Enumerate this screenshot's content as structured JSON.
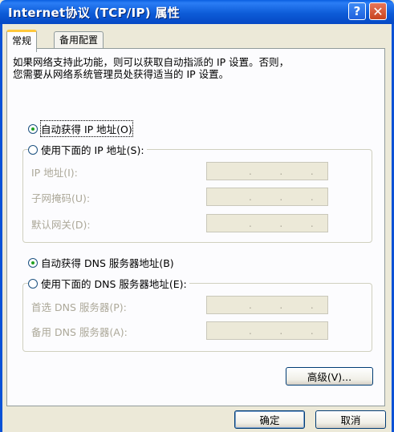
{
  "window": {
    "title": "Internet协议 (TCP/IP) 属性",
    "help_icon": "?",
    "close_icon": "✕"
  },
  "tabs": [
    {
      "label": "常规"
    },
    {
      "label": "备用配置"
    }
  ],
  "description": [
    "如果网络支持此功能，则可以获取自动指派的 IP 设置。否则，",
    "您需要从网络系统管理员处获得适当的 IP 设置。"
  ],
  "ip": {
    "auto_label": "自动获得 IP 地址(O)",
    "manual_label": "使用下面的 IP 地址(S):",
    "selected": "auto",
    "fields": [
      {
        "label": "IP 地址(I):",
        "value": ""
      },
      {
        "label": "子网掩码(U):",
        "value": ""
      },
      {
        "label": "默认网关(D):",
        "value": ""
      }
    ]
  },
  "dns": {
    "auto_label": "自动获得 DNS 服务器地址(B)",
    "manual_label": "使用下面的 DNS 服务器地址(E):",
    "selected": "auto",
    "fields": [
      {
        "label": "首选 DNS 服务器(P):",
        "value": ""
      },
      {
        "label": "备用 DNS 服务器(A):",
        "value": ""
      }
    ]
  },
  "buttons": {
    "advanced": "高级(V)...",
    "ok": "确定",
    "cancel": "取消"
  },
  "ip_dot": "."
}
